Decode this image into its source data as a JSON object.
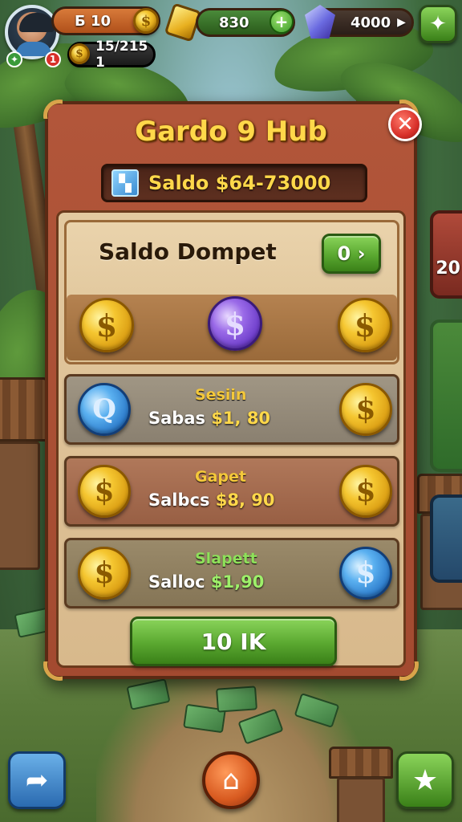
{
  "hud": {
    "level_value": "Б 10",
    "wallet_value": "15/215 1",
    "energy_value": "830",
    "gems_value": "4000",
    "avatar_badge": "1",
    "add_energy": "+",
    "play_arrow": "▶"
  },
  "panel": {
    "title": "Gardo 9 Hub",
    "close_label": "✕",
    "balance_text": "Saldo $64-73000"
  },
  "dompet": {
    "title": "Saldo Dompet",
    "button_label": "0 ›"
  },
  "rows": [
    {
      "title": "Sesiin",
      "label": "Sabas",
      "value": "$1, 80",
      "title_color": "#f4c83a"
    },
    {
      "title": "Gapet",
      "label": "Salbcs",
      "value": "$8, 90",
      "title_color": "#f4c83a"
    },
    {
      "title": "Slapett",
      "label": "Salloc",
      "value": "$1,90",
      "title_color": "#8ee05a"
    }
  ],
  "ok_button": "10 IK",
  "coin_symbol": "$",
  "search_symbol": "Q",
  "side_panel_text": "20",
  "colors": {
    "panel": "#a34a30",
    "title_gold": "#ffd84a",
    "button_green": "#5aa830",
    "close_red": "#d8302a"
  }
}
